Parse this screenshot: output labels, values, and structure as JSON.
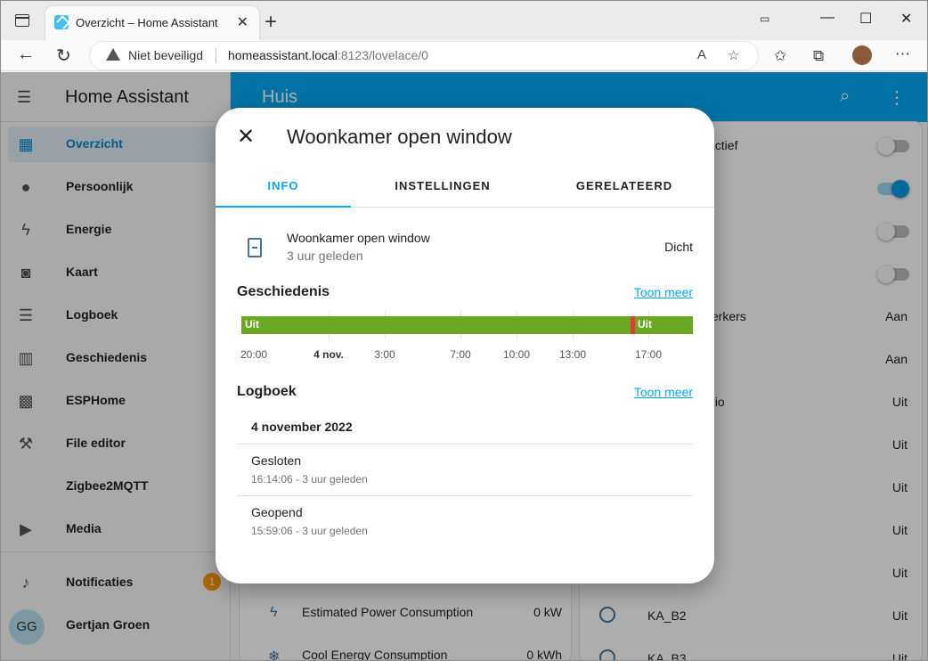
{
  "browser": {
    "tab_title": "Overzicht – Home Assistant",
    "tab_close": "✕",
    "new_tab": "+",
    "security_label": "Niet beveiligd",
    "url_host": "homeassistant.local",
    "url_rest": ":8123/lovelace/0"
  },
  "sidebar": {
    "title": "Home Assistant",
    "items": [
      {
        "label": "Overzicht",
        "icon": "dashboard-icon",
        "glyph": "▦"
      },
      {
        "label": "Persoonlijk",
        "icon": "person-icon",
        "glyph": "●"
      },
      {
        "label": "Energie",
        "icon": "lightning-icon",
        "glyph": "ϟ"
      },
      {
        "label": "Kaart",
        "icon": "map-icon",
        "glyph": "◙"
      },
      {
        "label": "Logboek",
        "icon": "logbook-icon",
        "glyph": "☰"
      },
      {
        "label": "Geschiedenis",
        "icon": "chart-icon",
        "glyph": "▥"
      },
      {
        "label": "ESPHome",
        "icon": "chip-icon",
        "glyph": "▩"
      },
      {
        "label": "File editor",
        "icon": "wrench-icon",
        "glyph": "⚒"
      },
      {
        "label": "Zigbee2MQTT",
        "icon": "zigbee-icon",
        "glyph": ""
      },
      {
        "label": "Media",
        "icon": "media-icon",
        "glyph": "▶"
      }
    ],
    "notifications": {
      "label": "Notificaties",
      "count": "1",
      "icon": "bell-icon"
    },
    "user": {
      "initials": "GG",
      "name": "Gertjan Groen"
    }
  },
  "topbar": {
    "title": "Huis"
  },
  "background": {
    "right_rows": [
      {
        "text": "actief",
        "value": ""
      },
      {
        "text": "",
        "value": ""
      },
      {
        "text": "",
        "value": ""
      },
      {
        "text": "",
        "value": ""
      },
      {
        "text": "terkers",
        "value": "Aan"
      },
      {
        "text": "",
        "value": "Aan"
      },
      {
        "text": "dio",
        "value": "Uit"
      },
      {
        "text": "",
        "value": "Uit"
      },
      {
        "text": "",
        "value": "Uit"
      },
      {
        "text": "",
        "value": "Uit"
      },
      {
        "text": "",
        "value": "Uit"
      },
      {
        "text": "KA_B2",
        "value": "Uit"
      },
      {
        "text": "KA_B3",
        "value": "Uit"
      }
    ],
    "left_rows": [
      {
        "text": "Estimated Power Consumption",
        "value": "0 kW"
      },
      {
        "text": "Cool Energy Consumption",
        "value": "0 kWh"
      }
    ]
  },
  "dialog": {
    "title": "Woonkamer open window",
    "tabs": [
      "INFO",
      "INSTELLINGEN",
      "GERELATEERD"
    ],
    "entity": {
      "name": "Woonkamer open window",
      "changed": "3 uur geleden",
      "state": "Dicht"
    },
    "history": {
      "title": "Geschiedenis",
      "more": "Toon meer",
      "bar_label_start": "Uit",
      "bar_label_end": "Uit",
      "colors": {
        "closed": "#6aa823",
        "open": "#e53935"
      },
      "axis": [
        "20:00",
        "4 nov.",
        "3:00",
        "7:00",
        "10:00",
        "13:00",
        "17:00"
      ]
    },
    "logbook": {
      "title": "Logboek",
      "more": "Toon meer",
      "date": "4 november 2022",
      "entries": [
        {
          "title": "Gesloten",
          "sub": "16:14:06 - 3 uur geleden"
        },
        {
          "title": "Geopend",
          "sub": "15:59:06 - 3 uur geleden"
        }
      ]
    }
  }
}
